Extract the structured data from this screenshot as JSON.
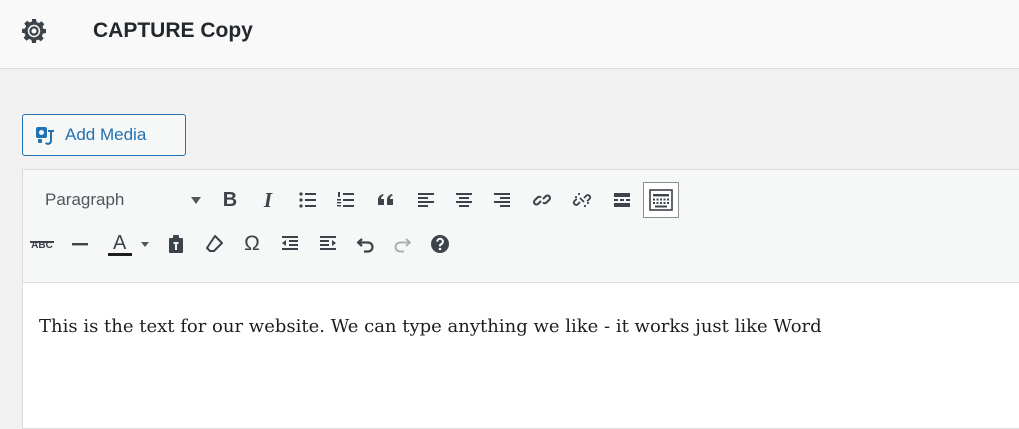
{
  "header": {
    "title": "CAPTURE Copy",
    "icon": "gear-icon"
  },
  "media": {
    "add_media_label": "Add Media",
    "icon": "add-media-icon"
  },
  "toolbar": {
    "format_select_value": "Paragraph",
    "row1": [
      "bold",
      "italic",
      "bulleted-list",
      "numbered-list",
      "blockquote",
      "align-left",
      "align-center",
      "align-right",
      "insert-link",
      "remove-link",
      "read-more",
      "toolbar-toggle"
    ],
    "row2": [
      "strikethrough",
      "horizontal-line",
      "text-color",
      "paste-as-text",
      "clear-formatting",
      "special-character",
      "decrease-indent",
      "increase-indent",
      "undo",
      "redo",
      "keyboard-shortcuts"
    ],
    "bold_glyph": "B",
    "italic_glyph": "I",
    "text_color_glyph": "A",
    "omega_glyph": "Ω",
    "abc_glyph": "ABC"
  },
  "editor": {
    "content": "This is the text for our website. We can type anything we like - it works just like Word"
  },
  "colors": {
    "accent": "#2271b1",
    "icon": "#3c434a",
    "text_color_underline": "#1e1e1e"
  }
}
